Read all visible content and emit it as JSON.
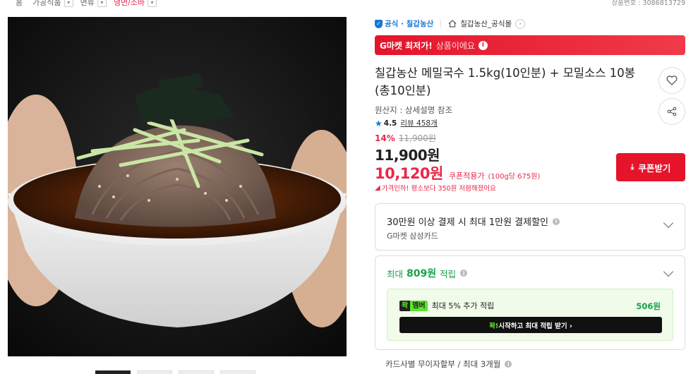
{
  "breadcrumb": [
    {
      "label": "홈",
      "active": false
    },
    {
      "label": "가공식품",
      "active": false
    },
    {
      "label": "면류",
      "active": false
    },
    {
      "label": "냉면/소바",
      "active": true
    }
  ],
  "product_number": "상품번호 : 3086813729",
  "seller": {
    "official_label": "공식 · 칠갑농산",
    "store_label": "칠갑농산_공식몰"
  },
  "lowest_banner": {
    "strong": "G마켓 최저가!",
    "sub": "상품이에요",
    "info_icon": "i"
  },
  "product": {
    "title": "칠갑농산 메밀국수 1.5kg(10인분) + 모밀소스 10봉 (총10인분)",
    "origin": "원산지 : 상세설명 참조",
    "rating": "4.5",
    "review_text": "리뷰 458개",
    "discount_pct": "14%",
    "original_price": "11,900원",
    "price": "11,900원",
    "coupon_price": "10,120원",
    "coupon_label": "쿠폰적용가",
    "unit_price": "(100g당 675원)",
    "price_drop": "가격인하! 평소보다 350원 저렴해졌어요",
    "coupon_button": "쿠폰받기"
  },
  "benefits": {
    "card_discount": "30만원 이상 결제 시 최대 1만원 결제할인",
    "card_name": "G마켓 삼성카드",
    "points_prefix": "최대",
    "points_amount": "809원",
    "points_suffix": "적립",
    "member_badge_a": "꽉",
    "member_badge_b": "멤버",
    "member_text": "최대 5% 추가 적립",
    "member_amount": "506원",
    "start_prefix": "꽉!",
    "start_text": " 시작하고 최대 적립 받기 ›",
    "installment": "카드사별 무이자할부 / 최대 3개월"
  },
  "icons": [
    "shield-icon",
    "home-icon",
    "heart-icon",
    "share-icon",
    "info-icon",
    "chevron-down-icon",
    "star-icon",
    "download-icon"
  ],
  "colors": {
    "accent_red": "#e5142b",
    "green": "#17a34a",
    "blue": "#1976d2"
  }
}
